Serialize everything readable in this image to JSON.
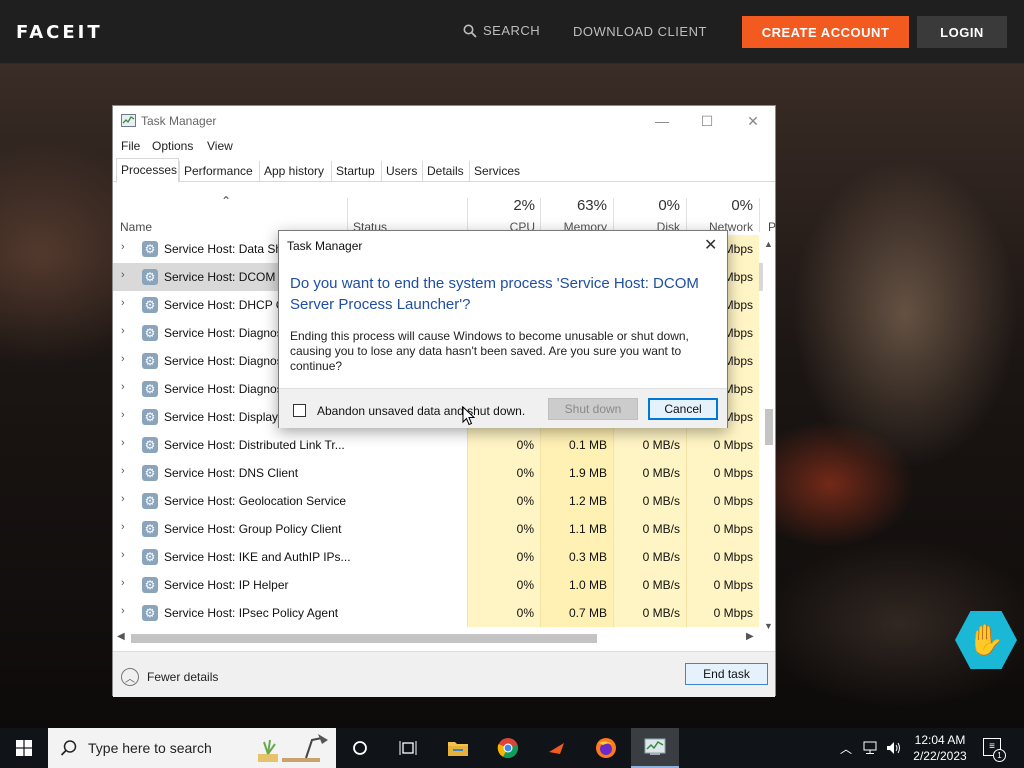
{
  "site": {
    "logo": "FACEIT",
    "nav": {
      "search": "SEARCH",
      "download": "DOWNLOAD CLIENT",
      "create_account": "CREATE ACCOUNT",
      "login": "LOGIN"
    },
    "accent_color": "#f35a1f"
  },
  "task_manager": {
    "title": "Task Manager",
    "menu": [
      "File",
      "Options",
      "View"
    ],
    "tabs": [
      "Processes",
      "Performance",
      "App history",
      "Startup",
      "Users",
      "Details",
      "Services"
    ],
    "active_tab": "Processes",
    "columns": {
      "name": "Name",
      "status": "Status",
      "cpu": {
        "pct": "2%",
        "label": "CPU"
      },
      "memory": {
        "pct": "63%",
        "label": "Memory"
      },
      "disk": {
        "pct": "0%",
        "label": "Disk"
      },
      "network": {
        "pct": "0%",
        "label": "Network"
      },
      "power_partial": "P"
    },
    "rows": [
      {
        "name": "Service Host: Data Sha",
        "cpu": "",
        "memory": "",
        "disk": "",
        "network": "Mbps",
        "selected": false
      },
      {
        "name": "Service Host: DCOM S",
        "cpu": "",
        "memory": "",
        "disk": "",
        "network": "Mbps",
        "selected": true
      },
      {
        "name": "Service Host: DHCP Cl",
        "cpu": "",
        "memory": "",
        "disk": "",
        "network": "Mbps",
        "selected": false
      },
      {
        "name": "Service Host: Diagnost",
        "cpu": "",
        "memory": "",
        "disk": "",
        "network": "Mbps",
        "selected": false
      },
      {
        "name": "Service Host: Diagnost",
        "cpu": "",
        "memory": "",
        "disk": "",
        "network": "Mbps",
        "selected": false
      },
      {
        "name": "Service Host: Diagnost",
        "cpu": "",
        "memory": "",
        "disk": "",
        "network": "Mbps",
        "selected": false
      },
      {
        "name": "Service Host: Display P",
        "cpu": "",
        "memory": "",
        "disk": "",
        "network": "Mbps",
        "selected": false
      },
      {
        "name": "Service Host: Distributed Link Tr...",
        "cpu": "0%",
        "memory": "0.1 MB",
        "disk": "0 MB/s",
        "network": "0 Mbps",
        "selected": false
      },
      {
        "name": "Service Host: DNS Client",
        "cpu": "0%",
        "memory": "1.9 MB",
        "disk": "0 MB/s",
        "network": "0 Mbps",
        "selected": false
      },
      {
        "name": "Service Host: Geolocation Service",
        "cpu": "0%",
        "memory": "1.2 MB",
        "disk": "0 MB/s",
        "network": "0 Mbps",
        "selected": false
      },
      {
        "name": "Service Host: Group Policy Client",
        "cpu": "0%",
        "memory": "1.1 MB",
        "disk": "0 MB/s",
        "network": "0 Mbps",
        "selected": false
      },
      {
        "name": "Service Host: IKE and AuthIP IPs...",
        "cpu": "0%",
        "memory": "0.3 MB",
        "disk": "0 MB/s",
        "network": "0 Mbps",
        "selected": false
      },
      {
        "name": "Service Host: IP Helper",
        "cpu": "0%",
        "memory": "1.0 MB",
        "disk": "0 MB/s",
        "network": "0 Mbps",
        "selected": false
      },
      {
        "name": "Service Host: IPsec Policy Agent",
        "cpu": "0%",
        "memory": "0.7 MB",
        "disk": "0 MB/s",
        "network": "0 Mbps",
        "selected": false
      }
    ],
    "footer": {
      "fewer_details": "Fewer details",
      "end_task": "End task"
    }
  },
  "dialog": {
    "title": "Task Manager",
    "heading": "Do you want to end the system process 'Service Host: DCOM Server Process Launcher'?",
    "body": "Ending this process will cause Windows to become unusable or shut down, causing you to lose any data hasn't been saved. Are you sure you want to continue?",
    "checkbox_label": "Abandon unsaved data and shut down.",
    "checkbox_checked": false,
    "shutdown_label": "Shut down",
    "cancel_label": "Cancel"
  },
  "taskbar": {
    "search_placeholder": "Type here to search",
    "time": "12:04 AM",
    "date": "2/22/2023",
    "notification_count": "1"
  }
}
